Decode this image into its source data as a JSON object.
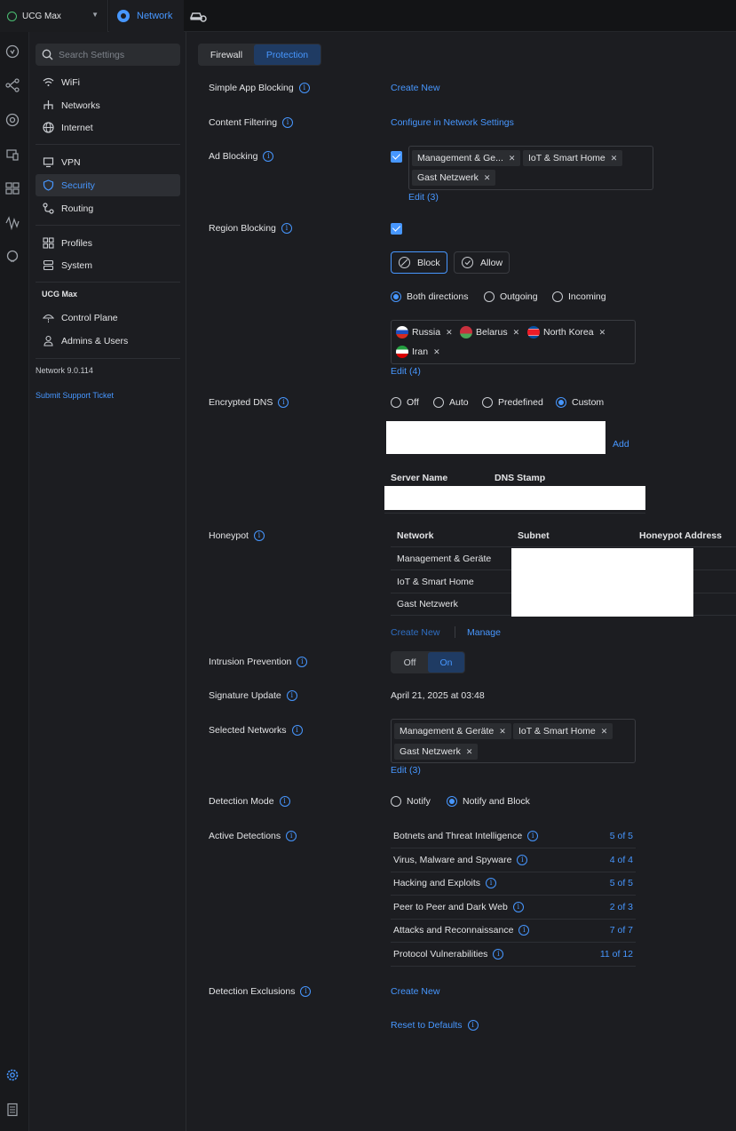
{
  "topbar": {
    "site_name": "UCG Max",
    "app_tab": "Network"
  },
  "sidebar": {
    "search_placeholder": "Search Settings",
    "group1": [
      {
        "label": "WiFi",
        "icon": "wifi-icon"
      },
      {
        "label": "Networks",
        "icon": "networks-icon"
      },
      {
        "label": "Internet",
        "icon": "globe-icon"
      }
    ],
    "group2": [
      {
        "label": "VPN",
        "icon": "vpn-icon"
      },
      {
        "label": "Security",
        "icon": "shield-icon",
        "active": true
      },
      {
        "label": "Routing",
        "icon": "routing-icon"
      }
    ],
    "group3": [
      {
        "label": "Profiles",
        "icon": "profiles-icon"
      },
      {
        "label": "System",
        "icon": "system-icon"
      }
    ],
    "device_heading": "UCG Max",
    "group4": [
      {
        "label": "Control Plane",
        "icon": "control-plane-icon"
      },
      {
        "label": "Admins & Users",
        "icon": "users-icon"
      }
    ],
    "version": "Network 9.0.114",
    "support_link": "Submit Support Ticket"
  },
  "tabs": [
    "Firewall",
    "Protection"
  ],
  "settings": {
    "simple_app_blocking": {
      "label": "Simple App Blocking",
      "action": "Create New"
    },
    "content_filtering": {
      "label": "Content Filtering",
      "action": "Configure in Network Settings"
    },
    "ad_blocking": {
      "label": "Ad Blocking",
      "enabled": true,
      "tags": [
        "Management & Ge...",
        "IoT & Smart Home",
        "Gast Netzwerk"
      ],
      "edit": "Edit (3)"
    },
    "region_blocking": {
      "label": "Region Blocking",
      "enabled": true,
      "mode_buttons": [
        "Block",
        "Allow"
      ],
      "direction_options": [
        "Both directions",
        "Outgoing",
        "Incoming"
      ],
      "selected_direction": "Both directions",
      "countries": [
        "Russia",
        "Belarus",
        "North Korea",
        "Iran"
      ],
      "edit": "Edit (4)"
    },
    "encrypted_dns": {
      "label": "Encrypted DNS",
      "options": [
        "Off",
        "Auto",
        "Predefined",
        "Custom"
      ],
      "selected": "Custom",
      "add_label": "Add",
      "table_headers": [
        "Server Name",
        "DNS Stamp"
      ]
    },
    "honeypot": {
      "label": "Honeypot",
      "headers": [
        "Network",
        "Subnet",
        "Honeypot Address"
      ],
      "rows": [
        "Management & Geräte",
        "IoT & Smart Home",
        "Gast Netzwerk"
      ],
      "create_new": "Create New",
      "manage": "Manage"
    },
    "intrusion_prevention": {
      "label": "Intrusion Prevention",
      "options": [
        "Off",
        "On"
      ],
      "selected": "On"
    },
    "signature_update": {
      "label": "Signature Update",
      "value": "April 21, 2025 at 03:48"
    },
    "selected_networks": {
      "label": "Selected Networks",
      "tags": [
        "Management & Geräte",
        "IoT & Smart Home",
        "Gast Netzwerk"
      ],
      "edit": "Edit (3)"
    },
    "detection_mode": {
      "label": "Detection Mode",
      "options": [
        "Notify",
        "Notify and Block"
      ],
      "selected": "Notify and Block"
    },
    "active_detections": {
      "label": "Active Detections",
      "rows": [
        {
          "name": "Botnets and Threat Intelligence",
          "count": "5 of 5"
        },
        {
          "name": "Virus, Malware and Spyware",
          "count": "4 of 4"
        },
        {
          "name": "Hacking and Exploits",
          "count": "5 of 5"
        },
        {
          "name": "Peer to Peer and Dark Web",
          "count": "2 of 3"
        },
        {
          "name": "Attacks and Reconnaissance",
          "count": "7 of 7"
        },
        {
          "name": "Protocol Vulnerabilities",
          "count": "11 of 12"
        }
      ]
    },
    "detection_exclusions": {
      "label": "Detection Exclusions",
      "action": "Create New"
    },
    "reset": "Reset to Defaults"
  },
  "colors": {
    "accent": "#4797ff",
    "background": "#1c1d21"
  }
}
